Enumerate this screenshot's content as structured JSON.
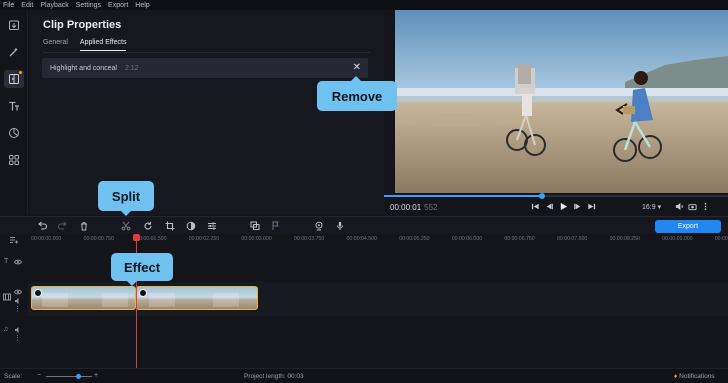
{
  "menu": [
    "File",
    "Edit",
    "Playback",
    "Settings",
    "Export",
    "Help"
  ],
  "sidebar": {
    "items": [
      {
        "icon": "import-icon",
        "active": false
      },
      {
        "icon": "magic-wand-icon",
        "active": false
      },
      {
        "icon": "transitions-icon",
        "active": true
      },
      {
        "icon": "titles-icon",
        "active": false
      },
      {
        "icon": "stickers-icon",
        "active": false
      },
      {
        "icon": "more-tools-icon",
        "active": false
      }
    ]
  },
  "properties": {
    "title": "Clip Properties",
    "tabs": [
      "General",
      "Applied Effects"
    ],
    "active_tab": "Applied Effects",
    "effect": {
      "name": "Highlight and conceal",
      "duration": "2:12"
    }
  },
  "player": {
    "time": "00:00:01",
    "frame": "552",
    "progress": 0.46,
    "aspect": "16:9 ▾"
  },
  "toolbar": {
    "export_label": "Export"
  },
  "ruler": [
    "00:00:00.000",
    "00:00:00.750",
    "00:00:01.500",
    "00:00:02.250",
    "00:00:03.000",
    "00:00:03.750",
    "00:00:04.500",
    "00:00:05.250",
    "00:00:06.000",
    "00:00:06.750",
    "00:00:07.500",
    "00:00:08.250",
    "00:00:09.000",
    "00:00:09.75"
  ],
  "status": {
    "scale_label": "Scale:",
    "scale_level": 0.7,
    "project_length": "Project length:  00:03",
    "notifications": "Notifications"
  },
  "callouts": {
    "remove": "Remove",
    "split": "Split",
    "effect": "Effect"
  },
  "colors": {
    "accent": "#1f86f2",
    "callout": "#6fc1ef",
    "playhead": "#e23b3b",
    "clip_border": "#e8b63a"
  }
}
